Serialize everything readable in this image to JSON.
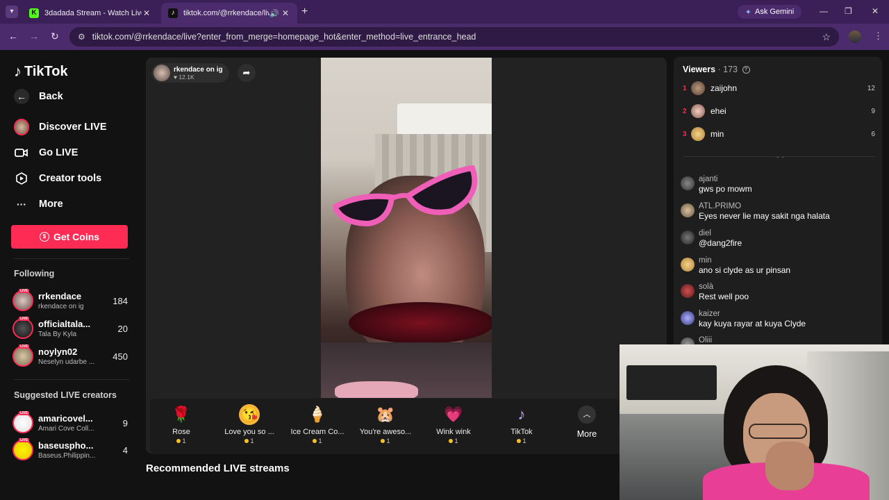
{
  "browser": {
    "tabs": [
      {
        "title": "3dadada Stream - Watch Live o",
        "active": false
      },
      {
        "title": "tiktok.com/@rrkendace/live",
        "active": true
      }
    ],
    "ask_gemini": "Ask Gemini",
    "url": "tiktok.com/@rrkendace/live?enter_from_merge=homepage_hot&enter_method=live_entrance_head"
  },
  "sidebar": {
    "brand": "TikTok",
    "nav": [
      {
        "label": "Back",
        "icon": "arrow-left-icon"
      },
      {
        "label": "Discover LIVE",
        "icon": "avatar"
      },
      {
        "label": "Go LIVE",
        "icon": "camera-icon"
      },
      {
        "label": "Creator tools",
        "icon": "play-square-icon"
      },
      {
        "label": "More",
        "icon": "ellipsis-icon"
      }
    ],
    "get_coins": "Get Coins",
    "following_title": "Following",
    "following": [
      {
        "name": "rrkendace",
        "sub": "rkendace on ig",
        "count": "184"
      },
      {
        "name": "officialtala...",
        "sub": "Tala By Kyla",
        "count": "20"
      },
      {
        "name": "noylyn02",
        "sub": "Neselyn udarbe ...",
        "count": "450"
      }
    ],
    "suggested_title": "Suggested LIVE creators",
    "suggested": [
      {
        "name": "amaricovel...",
        "sub": "Amari Cove Coll...",
        "count": "9"
      },
      {
        "name": "baseuspho...",
        "sub": "Baseus.Philippin...",
        "count": "4"
      }
    ],
    "live_badge": "LIVE"
  },
  "stream": {
    "host_name": "rkendace on ig",
    "host_likes": "12.1K",
    "gifts": [
      {
        "name": "Rose",
        "price": "1",
        "icon": "rose-icon"
      },
      {
        "name": "Love you so ...",
        "price": "1",
        "icon": "love-face-icon"
      },
      {
        "name": "Ice Cream Co...",
        "price": "1",
        "icon": "ice-cream-icon"
      },
      {
        "name": "You're aweso...",
        "price": "1",
        "icon": "hamster-icon"
      },
      {
        "name": "Wink wink",
        "price": "1",
        "icon": "heart-icon"
      },
      {
        "name": "TikTok",
        "price": "1",
        "icon": "tiktok-icon"
      }
    ],
    "more_label": "More",
    "recommended_title": "Recommended LIVE streams"
  },
  "viewers": {
    "title": "Viewers",
    "count": "173",
    "top": [
      {
        "rank": "1",
        "name": "zaijohn",
        "score": "12"
      },
      {
        "rank": "2",
        "name": "ehei",
        "score": "9"
      },
      {
        "rank": "3",
        "name": "min",
        "score": "6"
      }
    ]
  },
  "chat": [
    {
      "name": "ajanti",
      "text": "gws po mowm"
    },
    {
      "name": "ATL.PRIMO",
      "text": "Eyes never lie may sakit nga halata"
    },
    {
      "name": "diel",
      "text": "@dang2fire"
    },
    {
      "name": "min",
      "text": "ano si clyde as ur pinsan"
    },
    {
      "name": "solà",
      "text": "Rest well poo"
    },
    {
      "name": "kaizer",
      "text": "kay kuya rayar at kuya Clyde"
    },
    {
      "name": "Oliii",
      "text": ""
    }
  ],
  "colors": {
    "accent": "#fe2c55",
    "browser_frame": "#3b1f57",
    "page_bg": "#121212"
  }
}
